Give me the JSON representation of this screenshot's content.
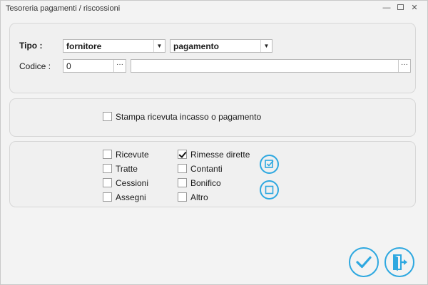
{
  "window": {
    "title": "Tesoreria pagamenti / riscossioni",
    "controls": {
      "minimize": "—",
      "close": "✕"
    }
  },
  "form": {
    "tipo_label": "Tipo :",
    "tipo_value": "fornitore",
    "tipo_mode": "pagamento",
    "codice_label": "Codice :",
    "codice_value": "0",
    "codice_description": "",
    "ellipsis": "···"
  },
  "print_option": {
    "label": "Stampa ricevuta incasso o pagamento",
    "checked": false
  },
  "payment_types": [
    {
      "label": "Ricevute",
      "checked": false
    },
    {
      "label": "Tratte",
      "checked": false
    },
    {
      "label": "Cessioni",
      "checked": false
    },
    {
      "label": "Assegni",
      "checked": false
    },
    {
      "label": "Rimesse dirette",
      "checked": true
    },
    {
      "label": "Contanti",
      "checked": false
    },
    {
      "label": "Bonifico",
      "checked": false
    },
    {
      "label": "Altro",
      "checked": false
    }
  ],
  "colors": {
    "accent": "#2ea8e0",
    "window_bg": "#f3f3f3",
    "panel_border": "#d7d7d7"
  },
  "icons": {
    "select_all": "check-all-icon",
    "deselect_all": "uncheck-all-icon",
    "confirm": "checkmark-icon",
    "exit": "exit-door-icon"
  }
}
